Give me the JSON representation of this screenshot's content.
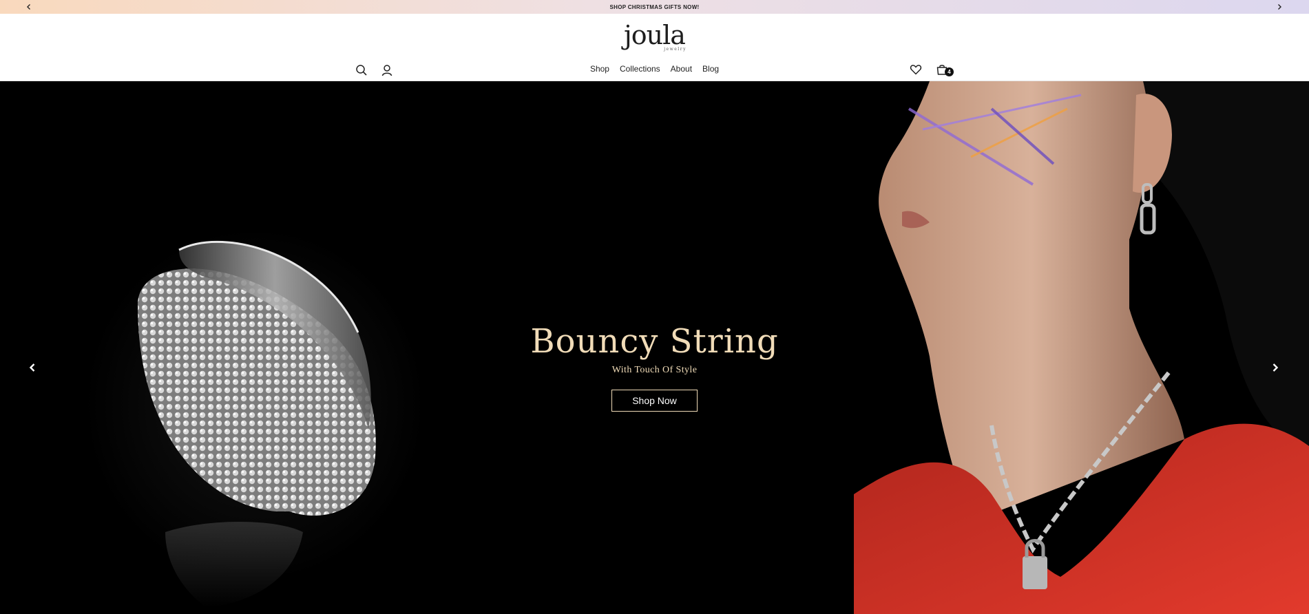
{
  "announcement": {
    "text": "SHOP CHRISTMAS GIFTS NOW!",
    "prev_icon": "chevron-left-icon",
    "next_icon": "chevron-right-icon"
  },
  "header": {
    "logo": {
      "main": "joula",
      "sub": "jewelry"
    },
    "left_icons": [
      "search-icon",
      "user-icon"
    ],
    "nav": [
      {
        "label": "Shop"
      },
      {
        "label": "Collections"
      },
      {
        "label": "About"
      },
      {
        "label": "Blog"
      }
    ],
    "right_icons": [
      "heart-icon",
      "cart-icon"
    ],
    "cart_count": "4"
  },
  "hero": {
    "title": "Bouncy String",
    "subtitle": "With Touch Of Style",
    "button_label": "Shop Now",
    "accent_color": "#f1dcb8",
    "prev_icon": "chevron-left-icon",
    "next_icon": "chevron-right-icon"
  }
}
